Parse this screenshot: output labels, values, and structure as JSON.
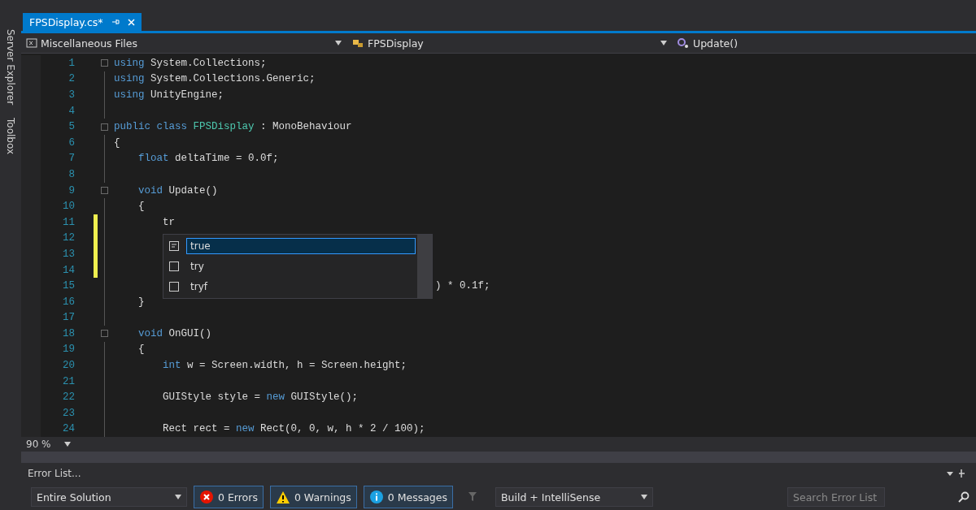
{
  "side_tabs": [
    "Server Explorer",
    "Toolbox"
  ],
  "tabs": [
    {
      "label": "FPSDisplay.cs*",
      "selected": true
    }
  ],
  "nav_bar": {
    "project": "Miscellaneous Files",
    "type": "FPSDisplay",
    "member": "Update()"
  },
  "code_lines": [
    {
      "n": "1",
      "fold": true,
      "tokens": [
        {
          "t": "using",
          "kind": "keyword"
        },
        {
          "t": " System.Collections;",
          "kind": "plain"
        }
      ]
    },
    {
      "n": "2",
      "tokens": [
        {
          "t": "using",
          "kind": "keyword"
        },
        {
          "t": " System.Collections.Generic;",
          "kind": "plain"
        }
      ]
    },
    {
      "n": "3",
      "tokens": [
        {
          "t": "using",
          "kind": "keyword"
        },
        {
          "t": " UnityEngine;",
          "kind": "plain"
        }
      ]
    },
    {
      "n": "4"
    },
    {
      "n": "5",
      "fold": true,
      "tokens": [
        {
          "t": "public class",
          "kind": "keyword"
        },
        {
          "t": " FPSDisplay",
          "kind": "type"
        },
        {
          "t": " : MonoBehaviour",
          "kind": "plain"
        }
      ]
    },
    {
      "n": "6",
      "tokens": [
        {
          "t": "{",
          "kind": "plain"
        }
      ]
    },
    {
      "n": "7",
      "tokens": [
        {
          "t": "    float",
          "kind": "keyword"
        },
        {
          "t": " deltaTime = 0.0f;",
          "kind": "plain"
        }
      ]
    },
    {
      "n": "8"
    },
    {
      "n": "9",
      "fold": true,
      "tokens": [
        {
          "t": "    void",
          "kind": "keyword"
        },
        {
          "t": " Update()",
          "kind": "plain"
        }
      ]
    },
    {
      "n": "10",
      "tokens": [
        {
          "t": "    {",
          "kind": "plain"
        }
      ]
    },
    {
      "n": "11",
      "changed": true,
      "tokens": [
        {
          "t": "        tr",
          "kind": "plain"
        }
      ]
    },
    {
      "n": "12",
      "changed": true
    },
    {
      "n": "13",
      "changed": true
    },
    {
      "n": "14",
      "changed": true
    },
    {
      "n": "15",
      "under_popup": true,
      "tokens": [
        {
          "t": ") * 0.1f;",
          "kind": "plain"
        }
      ]
    },
    {
      "n": "16",
      "tokens": [
        {
          "t": "    }",
          "kind": "plain"
        }
      ]
    },
    {
      "n": "17"
    },
    {
      "n": "18",
      "fold": true,
      "tokens": [
        {
          "t": "    void",
          "kind": "keyword"
        },
        {
          "t": " OnGUI()",
          "kind": "plain"
        }
      ]
    },
    {
      "n": "19",
      "tokens": [
        {
          "t": "    {",
          "kind": "plain"
        }
      ]
    },
    {
      "n": "20",
      "tokens": [
        {
          "t": "        int",
          "kind": "keyword"
        },
        {
          "t": " w = Screen.width, h = Screen.height;",
          "kind": "plain"
        }
      ]
    },
    {
      "n": "21"
    },
    {
      "n": "22",
      "tokens": [
        {
          "t": "        GUIStyle style = ",
          "kind": "plain"
        },
        {
          "t": "new",
          "kind": "keyword"
        },
        {
          "t": " GUIStyle();",
          "kind": "plain"
        }
      ]
    },
    {
      "n": "23"
    },
    {
      "n": "24",
      "tokens": [
        {
          "t": "        Rect rect = ",
          "kind": "plain"
        },
        {
          "t": "new",
          "kind": "keyword"
        },
        {
          "t": " Rect(0, 0, w, h * 2 / 100);",
          "kind": "plain"
        }
      ]
    }
  ],
  "completion": [
    {
      "label": "true",
      "selected": true
    },
    {
      "label": "try",
      "selected": false
    },
    {
      "label": "tryf",
      "selected": false
    }
  ],
  "zoom": "90 %",
  "error_list": {
    "title": "Error List...",
    "scope": "Entire Solution",
    "filters": [
      {
        "kind": "error",
        "label": "0 Errors",
        "on": true
      },
      {
        "kind": "warning",
        "label": "0 Warnings",
        "on": true
      },
      {
        "kind": "message",
        "label": "0 Messages",
        "on": true
      }
    ],
    "source": "Build + IntelliSense",
    "search": {
      "placeholder": "Search Error List"
    }
  }
}
